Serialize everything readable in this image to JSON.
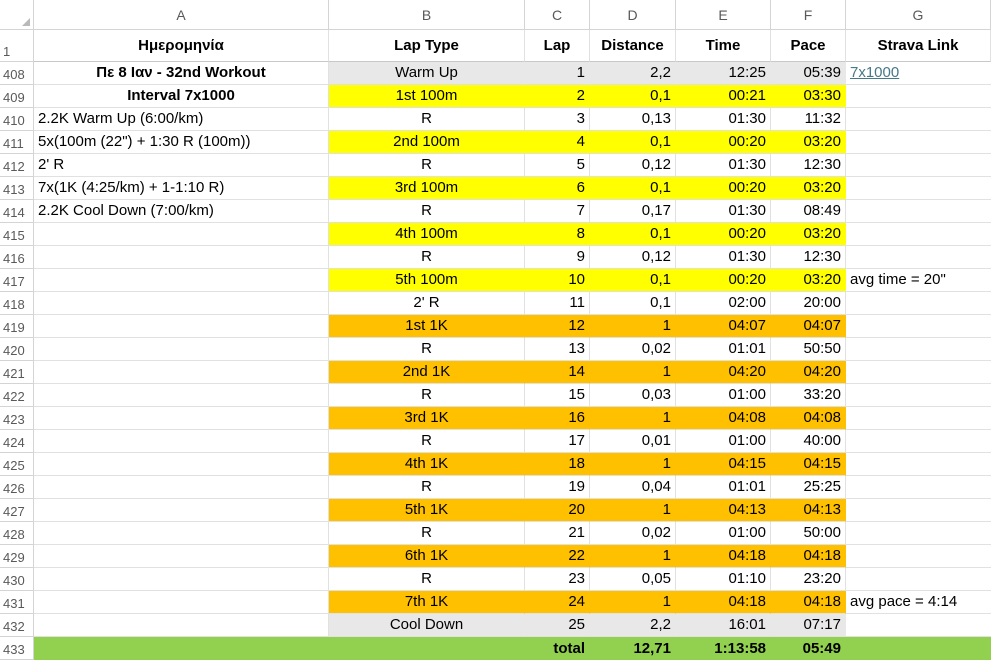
{
  "columns": [
    "A",
    "B",
    "C",
    "D",
    "E",
    "F",
    "G"
  ],
  "header_row": {
    "row_number": "1",
    "cells": [
      "Ημερομηνία",
      "Lap Type",
      "Lap",
      "Distance",
      "Time",
      "Pace",
      "Strava Link"
    ]
  },
  "rows": [
    {
      "n": "408",
      "a": "Πε 8 Ιαν - 32nd Workout",
      "a_bold": true,
      "a_align": "center",
      "b": "Warm Up",
      "c": "1",
      "d": "2,2",
      "e": "12:25",
      "f": "05:39",
      "g": "7x1000",
      "g_link": true,
      "fill": "gray"
    },
    {
      "n": "409",
      "a": "Interval 7x1000",
      "a_bold": true,
      "a_align": "center",
      "b": "1st 100m",
      "c": "2",
      "d": "0,1",
      "e": "00:21",
      "f": "03:30",
      "g": "",
      "fill": "yellow"
    },
    {
      "n": "410",
      "a": "2.2K Warm Up (6:00/km)",
      "b": "R",
      "c": "3",
      "d": "0,13",
      "e": "01:30",
      "f": "11:32",
      "g": "",
      "fill": "none"
    },
    {
      "n": "411",
      "a": "5x(100m (22\") + 1:30 R (100m))",
      "b": "2nd 100m",
      "c": "4",
      "d": "0,1",
      "e": "00:20",
      "f": "03:20",
      "g": "",
      "fill": "yellow"
    },
    {
      "n": "412",
      "a": "2' R",
      "b": "R",
      "c": "5",
      "d": "0,12",
      "e": "01:30",
      "f": "12:30",
      "g": "",
      "fill": "none"
    },
    {
      "n": "413",
      "a": "7x(1K (4:25/km) + 1-1:10 R)",
      "b": "3rd 100m",
      "c": "6",
      "d": "0,1",
      "e": "00:20",
      "f": "03:20",
      "g": "",
      "fill": "yellow"
    },
    {
      "n": "414",
      "a": "2.2K Cool Down (7:00/km)",
      "b": "R",
      "c": "7",
      "d": "0,17",
      "e": "01:30",
      "f": "08:49",
      "g": "",
      "fill": "none"
    },
    {
      "n": "415",
      "a": "",
      "b": "4th 100m",
      "c": "8",
      "d": "0,1",
      "e": "00:20",
      "f": "03:20",
      "g": "",
      "fill": "yellow"
    },
    {
      "n": "416",
      "a": "",
      "b": "R",
      "c": "9",
      "d": "0,12",
      "e": "01:30",
      "f": "12:30",
      "g": "",
      "fill": "none"
    },
    {
      "n": "417",
      "a": "",
      "b": "5th 100m",
      "c": "10",
      "d": "0,1",
      "e": "00:20",
      "f": "03:20",
      "g": "avg time = 20\"",
      "fill": "yellow"
    },
    {
      "n": "418",
      "a": "",
      "b": "2' R",
      "c": "11",
      "d": "0,1",
      "e": "02:00",
      "f": "20:00",
      "g": "",
      "fill": "none"
    },
    {
      "n": "419",
      "a": "",
      "b": "1st 1K",
      "c": "12",
      "d": "1",
      "e": "04:07",
      "f": "04:07",
      "g": "",
      "fill": "orange"
    },
    {
      "n": "420",
      "a": "",
      "b": "R",
      "c": "13",
      "d": "0,02",
      "e": "01:01",
      "f": "50:50",
      "g": "",
      "fill": "none"
    },
    {
      "n": "421",
      "a": "",
      "b": "2nd 1K",
      "c": "14",
      "d": "1",
      "e": "04:20",
      "f": "04:20",
      "g": "",
      "fill": "orange"
    },
    {
      "n": "422",
      "a": "",
      "b": "R",
      "c": "15",
      "d": "0,03",
      "e": "01:00",
      "f": "33:20",
      "g": "",
      "fill": "none"
    },
    {
      "n": "423",
      "a": "",
      "b": "3rd 1K",
      "c": "16",
      "d": "1",
      "e": "04:08",
      "f": "04:08",
      "g": "",
      "fill": "orange"
    },
    {
      "n": "424",
      "a": "",
      "b": "R",
      "c": "17",
      "d": "0,01",
      "e": "01:00",
      "f": "40:00",
      "g": "",
      "fill": "none"
    },
    {
      "n": "425",
      "a": "",
      "b": "4th 1K",
      "c": "18",
      "d": "1",
      "e": "04:15",
      "f": "04:15",
      "g": "",
      "fill": "orange"
    },
    {
      "n": "426",
      "a": "",
      "b": "R",
      "c": "19",
      "d": "0,04",
      "e": "01:01",
      "f": "25:25",
      "g": "",
      "fill": "none"
    },
    {
      "n": "427",
      "a": "",
      "b": "5th 1K",
      "c": "20",
      "d": "1",
      "e": "04:13",
      "f": "04:13",
      "g": "",
      "fill": "orange"
    },
    {
      "n": "428",
      "a": "",
      "b": "R",
      "c": "21",
      "d": "0,02",
      "e": "01:00",
      "f": "50:00",
      "g": "",
      "fill": "none"
    },
    {
      "n": "429",
      "a": "",
      "b": "6th 1K",
      "c": "22",
      "d": "1",
      "e": "04:18",
      "f": "04:18",
      "g": "",
      "fill": "orange"
    },
    {
      "n": "430",
      "a": "",
      "b": "R",
      "c": "23",
      "d": "0,05",
      "e": "01:10",
      "f": "23:20",
      "g": "",
      "fill": "none"
    },
    {
      "n": "431",
      "a": "",
      "b": "7th 1K",
      "c": "24",
      "d": "1",
      "e": "04:18",
      "f": "04:18",
      "g": "avg pace = 4:14",
      "fill": "orange"
    },
    {
      "n": "432",
      "a": "",
      "b": "Cool Down",
      "c": "25",
      "d": "2,2",
      "e": "16:01",
      "f": "07:17",
      "g": "",
      "fill": "gray"
    }
  ],
  "total_row": {
    "n": "433",
    "label": "total",
    "distance": "12,71",
    "time": "1:13:58",
    "pace": "05:49"
  },
  "colors": {
    "yellow": "#ffff00",
    "orange": "#ffc000",
    "gray": "#e8e8e8",
    "green": "#92d050",
    "link": "#467886",
    "gridline": "#e1e1e1"
  }
}
